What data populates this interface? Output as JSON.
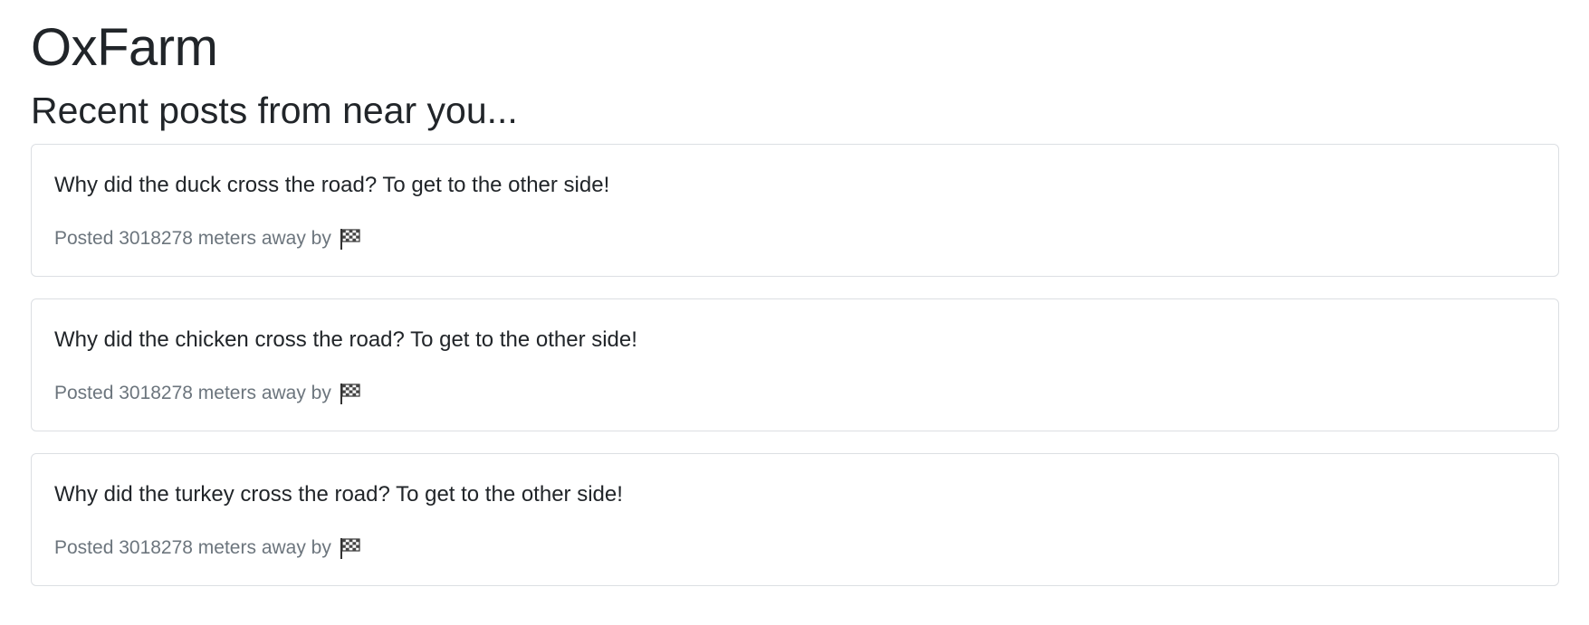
{
  "site": {
    "title": "OxFarm"
  },
  "section": {
    "title": "Recent posts from near you..."
  },
  "posts": [
    {
      "text": "Why did the duck cross the road? To get to the other side!",
      "meta": "Posted 3018278 meters away by",
      "author_icon": "chequered-flag-icon"
    },
    {
      "text": "Why did the chicken cross the road? To get to the other side!",
      "meta": "Posted 3018278 meters away by",
      "author_icon": "chequered-flag-icon"
    },
    {
      "text": "Why did the turkey cross the road? To get to the other side!",
      "meta": "Posted 3018278 meters away by",
      "author_icon": "chequered-flag-icon"
    }
  ]
}
